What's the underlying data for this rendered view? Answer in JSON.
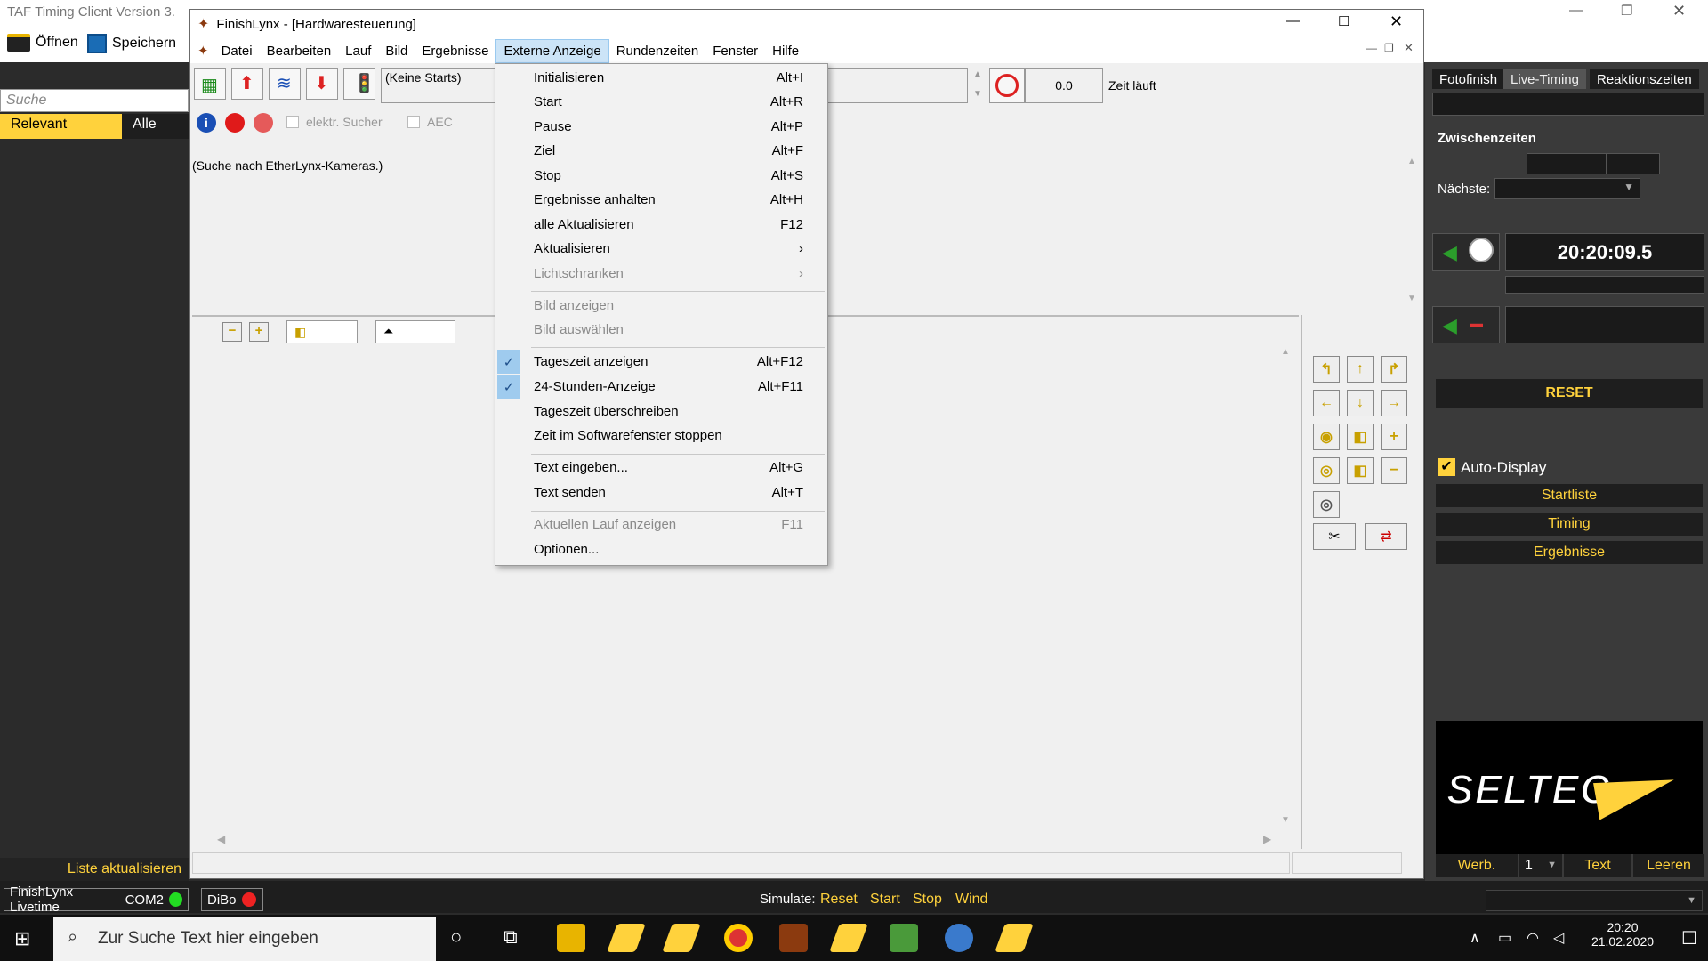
{
  "taf": {
    "title": "TAF Timing Client Version 3.",
    "open": "Öffnen",
    "save": "Speichern",
    "search_placeholder": "Suche",
    "tab_relevant": "Relevant",
    "tab_all": "Alle",
    "refresh_list": "Liste aktualisieren"
  },
  "finishlynx": {
    "title": "FinishLynx - [Hardwaresteuerung]",
    "menus": [
      "Datei",
      "Bearbeiten",
      "Lauf",
      "Bild",
      "Ergebnisse",
      "Externe Anzeige",
      "Rundenzeiten",
      "Fenster",
      "Hilfe"
    ],
    "no_starts": "(Keine Starts)",
    "time_value": "0.0",
    "time_running": "Zeit läuft",
    "checkbox_searcher": "elektr. Sucher",
    "checkbox_aec": "AEC",
    "camera_search": "(Suche nach EtherLynx-Kameras.)"
  },
  "dropdown": {
    "items": [
      {
        "label": "Initialisieren",
        "accel": "Alt+I",
        "disabled": false
      },
      {
        "label": "Start",
        "accel": "Alt+R",
        "disabled": false
      },
      {
        "label": "Pause",
        "accel": "Alt+P",
        "disabled": false
      },
      {
        "label": "Ziel",
        "accel": "Alt+F",
        "disabled": false
      },
      {
        "label": "Stop",
        "accel": "Alt+S",
        "disabled": false
      },
      {
        "label": "Ergebnisse anhalten",
        "accel": "Alt+H",
        "disabled": false
      },
      {
        "label": "alle Aktualisieren",
        "accel": "F12",
        "disabled": false
      },
      {
        "label": "Aktualisieren",
        "accel": "›",
        "disabled": false
      },
      {
        "label": "Lichtschranken",
        "accel": "›",
        "disabled": true
      },
      {
        "label": "Bild anzeigen",
        "accel": "",
        "disabled": true
      },
      {
        "label": "Bild auswählen",
        "accel": "",
        "disabled": true
      },
      {
        "label": "Tageszeit anzeigen",
        "accel": "Alt+F12",
        "checked": true
      },
      {
        "label": "24-Stunden-Anzeige",
        "accel": "Alt+F11",
        "checked": true
      },
      {
        "label": "Tageszeit überschreiben",
        "accel": ""
      },
      {
        "label": "Zeit im Softwarefenster stoppen",
        "accel": ""
      },
      {
        "label": "Text eingeben...",
        "accel": "Alt+G"
      },
      {
        "label": "Text senden",
        "accel": "Alt+T"
      },
      {
        "label": "Aktuellen Lauf anzeigen",
        "accel": "F11",
        "disabled": true
      },
      {
        "label": "Optionen...",
        "accel": ""
      }
    ]
  },
  "right": {
    "tab_fotofinish": "Fotofinish",
    "tab_live": "Live-Timing",
    "tab_reaction": "Reaktionszeiten",
    "splits": "Zwischenzeiten",
    "next": "Nächste:",
    "time": "20:20:09.5",
    "reset": "RESET",
    "auto_display": "Auto-Display",
    "startlist": "Startliste",
    "timing": "Timing",
    "results": "Ergebnisse",
    "logo": "SELTEC",
    "ad": "Werb.",
    "ad_num": "1",
    "text": "Text",
    "clear": "Leeren"
  },
  "status": {
    "livetime": "FinishLynx Livetime",
    "com": "COM2",
    "dibo": "DiBo",
    "simulate": "Simulate:",
    "sim_reset": "Reset",
    "sim_start": "Start",
    "sim_stop": "Stop",
    "sim_wind": "Wind"
  },
  "taskbar": {
    "search": "Zur Suche Text hier eingeben",
    "time": "20:20",
    "date": "21.02.2020"
  },
  "colors": {
    "accent_yellow": "#ffd23c",
    "led_green": "#22dd22",
    "led_red": "#ee2222"
  }
}
